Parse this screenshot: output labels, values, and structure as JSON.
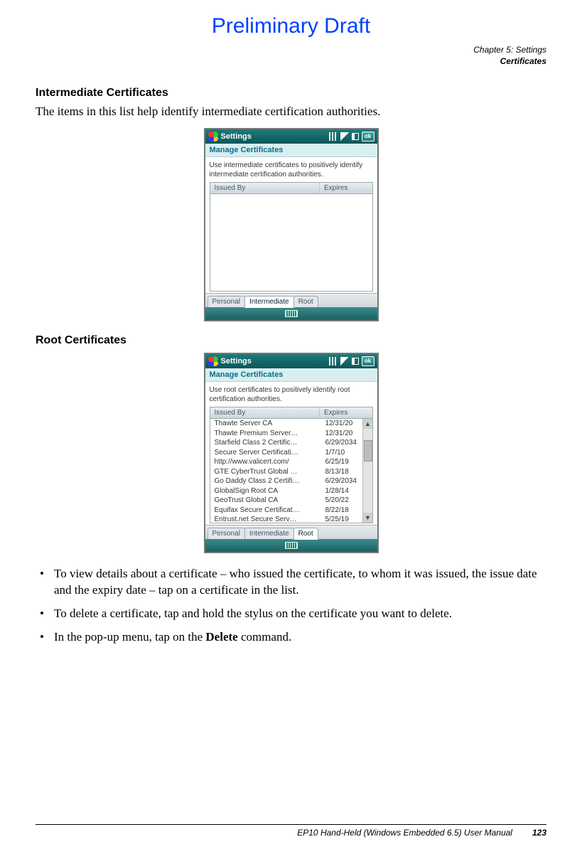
{
  "banner": "Preliminary Draft",
  "header": {
    "chapter": "Chapter 5: Settings",
    "section": "Certificates"
  },
  "sec1": {
    "heading": "Intermediate Certificates",
    "body": "The items in this list help identify intermediate certification authorities."
  },
  "sec2": {
    "heading": "Root Certificates"
  },
  "wm_common": {
    "title": "Settings",
    "subhead": "Manage Certificates",
    "ok": "ok",
    "col_issued": "Issued By",
    "col_expires": "Expires",
    "tab_personal": "Personal",
    "tab_intermediate": "Intermediate",
    "tab_root": "Root"
  },
  "wm1": {
    "desc": "Use intermediate certificates to positively identify intermediate certification authorities.",
    "rows": []
  },
  "wm2": {
    "desc": "Use root certificates to positively identify root certification authorities.",
    "rows": [
      {
        "name": "Thawte Server CA",
        "exp": "12/31/20"
      },
      {
        "name": "Thawte Premium Server…",
        "exp": "12/31/20"
      },
      {
        "name": "Starfield Class 2 Certific…",
        "exp": "6/29/2034"
      },
      {
        "name": "Secure Server Certificati…",
        "exp": "1/7/10"
      },
      {
        "name": "http://www.valicert.com/",
        "exp": "6/25/19"
      },
      {
        "name": "GTE CyberTrust Global …",
        "exp": "8/13/18"
      },
      {
        "name": "Go Daddy Class 2 Certifi…",
        "exp": "6/29/2034"
      },
      {
        "name": "GlobalSign Root CA",
        "exp": "1/28/14"
      },
      {
        "name": "GeoTrust Global CA",
        "exp": "5/20/22"
      },
      {
        "name": "Equifax Secure Certificat…",
        "exp": "8/22/18"
      },
      {
        "name": "Entrust.net Secure Serv…",
        "exp": "5/25/19"
      }
    ]
  },
  "bullets": {
    "b1": "To view details about a certificate – who issued the certificate, to whom it was issued, the issue date and the expiry date – tap on a certificate in the list.",
    "b2": "To delete a certificate, tap and hold the stylus on the certificate you want to delete.",
    "b3_pre": "In the pop-up menu, tap on the ",
    "b3_bold": "Delete",
    "b3_post": " command."
  },
  "footer": {
    "manual": "EP10 Hand-Held (Windows Embedded 6.5) User Manual",
    "page": "123"
  }
}
